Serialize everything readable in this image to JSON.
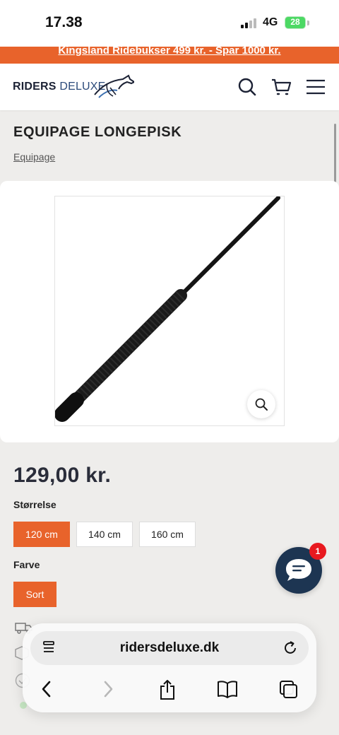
{
  "status_bar": {
    "time": "17.38",
    "network": "4G",
    "battery": "28"
  },
  "promo": {
    "text": "Kingsland Ridebukser 499 kr. - Spar 1000 kr."
  },
  "header": {
    "logo_part1": "RIDERS",
    "logo_part2": "DELUXE",
    "icons": [
      "search-icon",
      "cart-icon",
      "menu-icon"
    ]
  },
  "product": {
    "title": "EQUIPAGE LONGEPISK",
    "breadcrumb": "Equipage",
    "price": "129,00 kr."
  },
  "options": {
    "size_label": "Størrelse",
    "sizes": [
      "120 cm",
      "140 cm",
      "160 cm"
    ],
    "selected_size": "120 cm",
    "color_label": "Farve",
    "colors": [
      "Sort"
    ],
    "selected_color": "Sort"
  },
  "chat": {
    "badge": "1"
  },
  "safari": {
    "url": "ridersdeluxe.dk"
  },
  "colors": {
    "accent": "#e8632b",
    "chat": "#1d3552",
    "badge": "#e8191f"
  }
}
